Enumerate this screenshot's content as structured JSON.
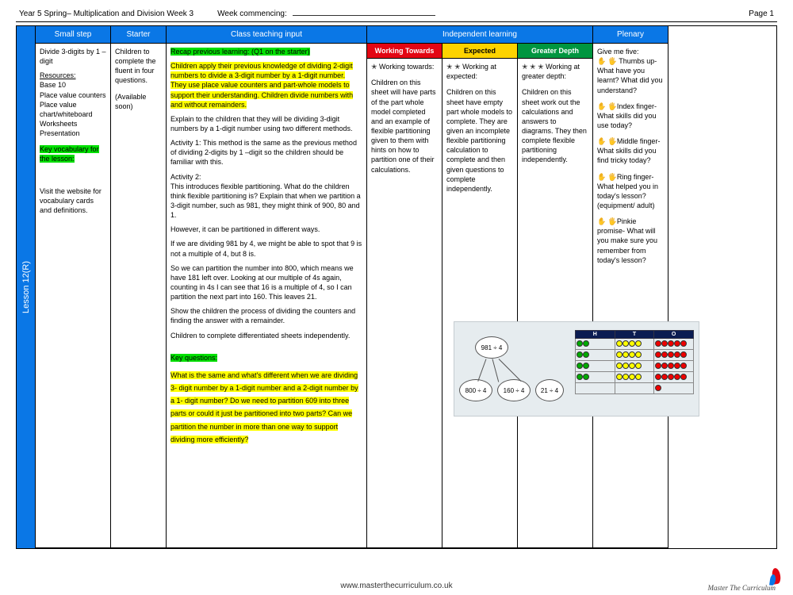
{
  "header": {
    "title": "Year 5 Spring– Multiplication and Division Week 3",
    "week_label": "Week commencing:",
    "page": "Page 1"
  },
  "rail": {
    "lesson": "Lesson 12(R)"
  },
  "columns": {
    "c1": "Small step",
    "c2": "Starter",
    "c3": "Class teaching input",
    "c4": "Independent learning",
    "c5": "Plenary"
  },
  "small_step": {
    "title": "Divide 3-digits by 1 – digit",
    "res_h": "Resources:",
    "res": [
      "Base 10",
      "Place value counters",
      "Place value chart/whiteboard",
      "Worksheets",
      "Presentation"
    ],
    "vocab_h": "Key vocabulary for the lesson:",
    "note": "Visit the website for vocabulary cards and definitions."
  },
  "starter": {
    "text": "Children to complete the fluent in four questions.",
    "avail": "(Available soon)"
  },
  "teaching": {
    "recap": "Recap previous learning: (Q1 on the starter)",
    "p1": "Children apply their previous knowledge of dividing 2-digit numbers to divide a 3-digit number by a 1-digit number. They use place value counters and part-whole models to support their understanding. Children divide numbers with and without remainders.",
    "p2": "Explain to the children that they will be dividing 3-digit numbers by a 1-digit number using two different methods.",
    "p3": "Activity 1: This method is the same as the previous method of dividing 2-digits by 1 –digit so the children should be familiar with this.",
    "p4": "Activity 2:\nThis introduces flexible partitioning. What do the children think flexible partitioning is? Explain that when we partition a 3-digit number, such as 981, they might think of 900, 80 and 1.",
    "p5": "However, it can be partitioned in different ways.",
    "p6": "If we are dividing 981 by 4, we might be able to spot that 9 is not a multiple of 4, but 8 is.",
    "p7": "So we can partition the number into 800, which means we have 181 left over. Looking at our multiple of 4s again, counting in 4s I can see that 16 is a multiple of 4, so I can partition the next part into 160. This leaves 21.",
    "p8": "Show the children the process of dividing the counters and finding the answer with a remainder.",
    "p9": "Children to complete differentiated sheets independently.",
    "kq_h": "Key questions:",
    "kq": "What is the same and what's different when we are dividing 3- digit number by a 1-digit number and a 2-digit number by a 1- digit number? Do we need to partition 609 into three parts or could it just be partitioned into two parts? Can we partition the number in more than one way to support dividing more efficiently?"
  },
  "il": {
    "wt_h": "Working Towards",
    "ex_h": "Expected",
    "gd_h": "Greater Depth",
    "wt_stars": "✭  Working towards:",
    "ex_stars": "✭ ✭ Working at expected:",
    "gd_stars": "✭ ✭ ✭ Working at greater depth:",
    "wt": "Children on this sheet will have parts of the part whole model completed and an example of flexible partitioning given to them with hints on how to partition one of their calculations.",
    "ex": "Children on this sheet have empty part whole models to complete. They are given an incomplete flexible partitioning calculation to complete and then given questions to complete independently.",
    "gd": "Children on this sheet work out the calculations and answers to diagrams. They then complete flexible partitioning independently."
  },
  "plenary": {
    "h": "Give me five:",
    "items": [
      "✋ 🖐 Thumbs up- What have you learnt? What did you understand?",
      "✋ 🖐Index finger- What skills did you use today?",
      "✋ 🖐Middle finger- What skills did you find tricky today?",
      "✋ 🖐Ring finger- What helped you in today's lesson? (equipment/ adult)",
      "✋ 🖐Pinkie promise- What will you make sure you remember from today's lesson?"
    ]
  },
  "diagram": {
    "top": "981 ÷ 4",
    "parts": [
      "800 ÷ 4",
      "160 ÷ 4",
      "21 ÷ 4"
    ],
    "pv_heads": [
      "H",
      "T",
      "O"
    ]
  },
  "footer": {
    "url": "www.masterthecurriculum.co.uk",
    "brand": "Master The Curriculum"
  }
}
